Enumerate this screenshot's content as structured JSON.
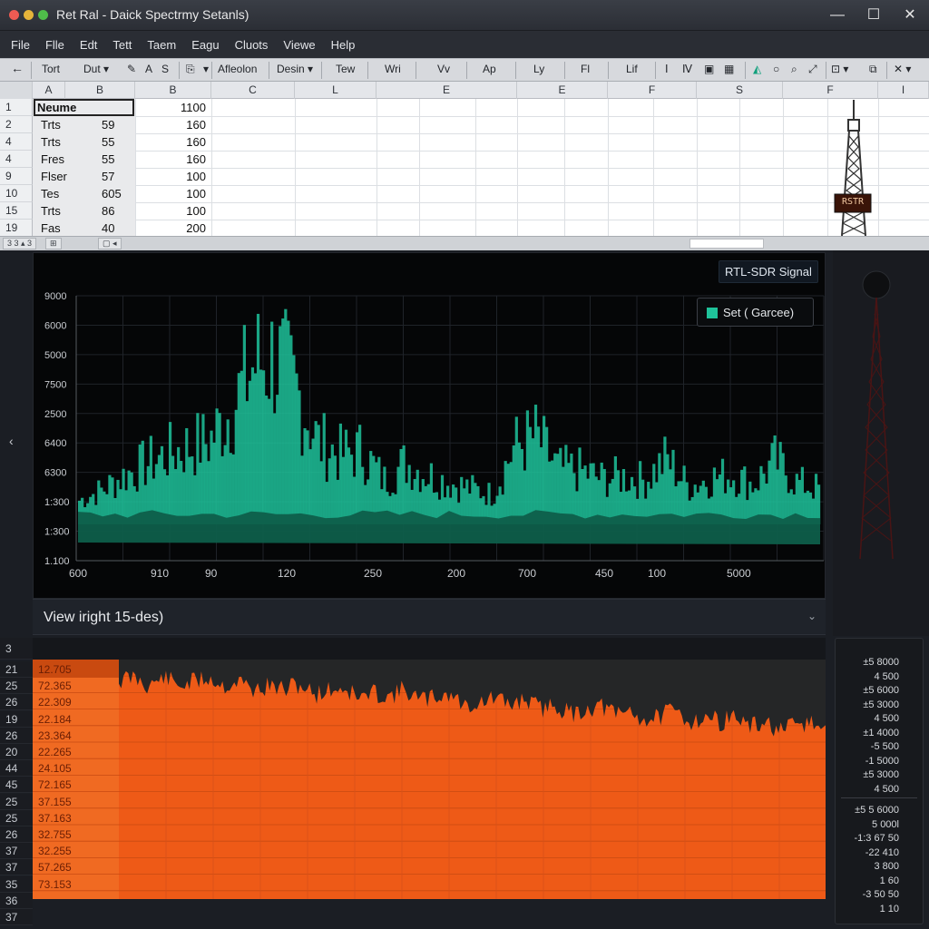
{
  "window": {
    "title": "Ret Ral - Daick Spectrmy Setanls)",
    "minimize": "—",
    "maximize": "☐",
    "close": "✕"
  },
  "menu": [
    "File",
    "Flle",
    "Edt",
    "Tett",
    "Taem",
    "Eagu",
    "Cluots",
    "Viewe",
    "Help"
  ],
  "toolbar": {
    "items": [
      "Tort",
      "Dut ▾",
      "A",
      "S",
      "▾",
      "Afleolon",
      "Desin ▾",
      "Tew",
      "Wri",
      "Vv",
      "Ap",
      "Ly",
      "Fl",
      "Lif"
    ]
  },
  "sheet": {
    "columns": [
      "A",
      "B",
      "B",
      "C",
      "L",
      "E",
      "E",
      "F",
      "S",
      "F",
      "I"
    ],
    "rows": [
      {
        "num": "1",
        "name": "Neume",
        "val": "",
        "b": "1100"
      },
      {
        "num": "2",
        "name": "Trts",
        "val": "59",
        "b": "160"
      },
      {
        "num": "4",
        "name": "Trts",
        "val": "55",
        "b": "160"
      },
      {
        "num": "4",
        "name": "Fres",
        "val": "55",
        "b": "160"
      },
      {
        "num": "9",
        "name": "Flser",
        "val": "57",
        "b": "100"
      },
      {
        "num": "10",
        "name": "Tes",
        "val": "605",
        "b": "100"
      },
      {
        "num": "15",
        "name": "Trts",
        "val": "86",
        "b": "100"
      },
      {
        "num": "19",
        "name": "Fas",
        "val": "40",
        "b": "200"
      }
    ],
    "tower_label": "RSTR",
    "sheet_tabs": [
      "3 3 ▴ 3",
      "⊞",
      "▢ ◂"
    ]
  },
  "colors": {
    "spectrum": "#1fc29a",
    "spectrum_dark": "#0e5e4a",
    "waterfall": "#ee5a17",
    "waterfall_dark": "#252627"
  },
  "chart_data": {
    "type": "area",
    "title": "RTL-SDR Signal",
    "series": [
      {
        "name": "Set ( Garcee)",
        "values": [
          1200,
          1700,
          2400,
          3000,
          3500,
          3900,
          4200,
          5800,
          8000,
          8400,
          6700,
          4100,
          3500,
          3700,
          2200,
          3100,
          2500,
          2100,
          1800,
          1500,
          3900,
          4400,
          2800,
          2700,
          2300,
          2400,
          2200,
          3300,
          1900,
          2300,
          2500,
          2000,
          3200,
          2100,
          1800
        ]
      }
    ],
    "y_tick_labels": [
      "9000",
      "6000",
      "5000",
      "7500",
      "2500",
      "6400",
      "6300",
      "1:300",
      "1:300",
      "1.100"
    ],
    "x_tick_labels": [
      "600",
      "910",
      "90",
      "120",
      "250",
      "200",
      "700",
      "450",
      "100",
      "5000"
    ],
    "grid": true,
    "legend": "top-right"
  },
  "view": {
    "label": "View iright 15-des)",
    "chevron": "⌄"
  },
  "waterfall": {
    "header_row": "3",
    "rows": [
      {
        "num": "21",
        "label": "12.705"
      },
      {
        "num": "25",
        "label": "72.365"
      },
      {
        "num": "26",
        "label": "22.309"
      },
      {
        "num": "19",
        "label": "22.184"
      },
      {
        "num": "26",
        "label": "23.364"
      },
      {
        "num": "20",
        "label": "22.265"
      },
      {
        "num": "44",
        "label": "24.105"
      },
      {
        "num": "45",
        "label": "72.165"
      },
      {
        "num": "25",
        "label": "37.155"
      },
      {
        "num": "25",
        "label": "37.163"
      },
      {
        "num": "26",
        "label": "32.755"
      },
      {
        "num": "37",
        "label": "32.255"
      },
      {
        "num": "37",
        "label": "57.265"
      },
      {
        "num": "35",
        "label": "73.153"
      },
      {
        "num": "36",
        "label": ""
      },
      {
        "num": "37",
        "label": ""
      }
    ],
    "profile": [
      0.55,
      0.85,
      0.3,
      0.9,
      0.4,
      0.7,
      0.95,
      0.5,
      0.8,
      0.35,
      0.6,
      0.45,
      0.75,
      0.3,
      0.55,
      0.65,
      0.25,
      0.5,
      0.4,
      0.7,
      0.3,
      0.45,
      0.6,
      0.2,
      0.35,
      0.5,
      0.3,
      0.55,
      0.25,
      0.4,
      0.15,
      0.3,
      0.45,
      0.2,
      0.35,
      0.1,
      0.25,
      0.4,
      0.15,
      0.3,
      0.2,
      0.35,
      0.1,
      0.25,
      0.05,
      0.2,
      0.3,
      0.1
    ]
  },
  "scale": {
    "items": [
      "±5 8000",
      "4 500",
      "±5 6000",
      "±5 3000",
      "4 500",
      "±1 4000",
      "-5 500",
      "-1 5000",
      "±5 3000",
      "4 500",
      "±5 5 6000",
      "5 000l",
      "-1:3 67 50",
      "-22 410",
      "3 800",
      "1 60",
      "-3 50 50",
      "1 10"
    ]
  }
}
